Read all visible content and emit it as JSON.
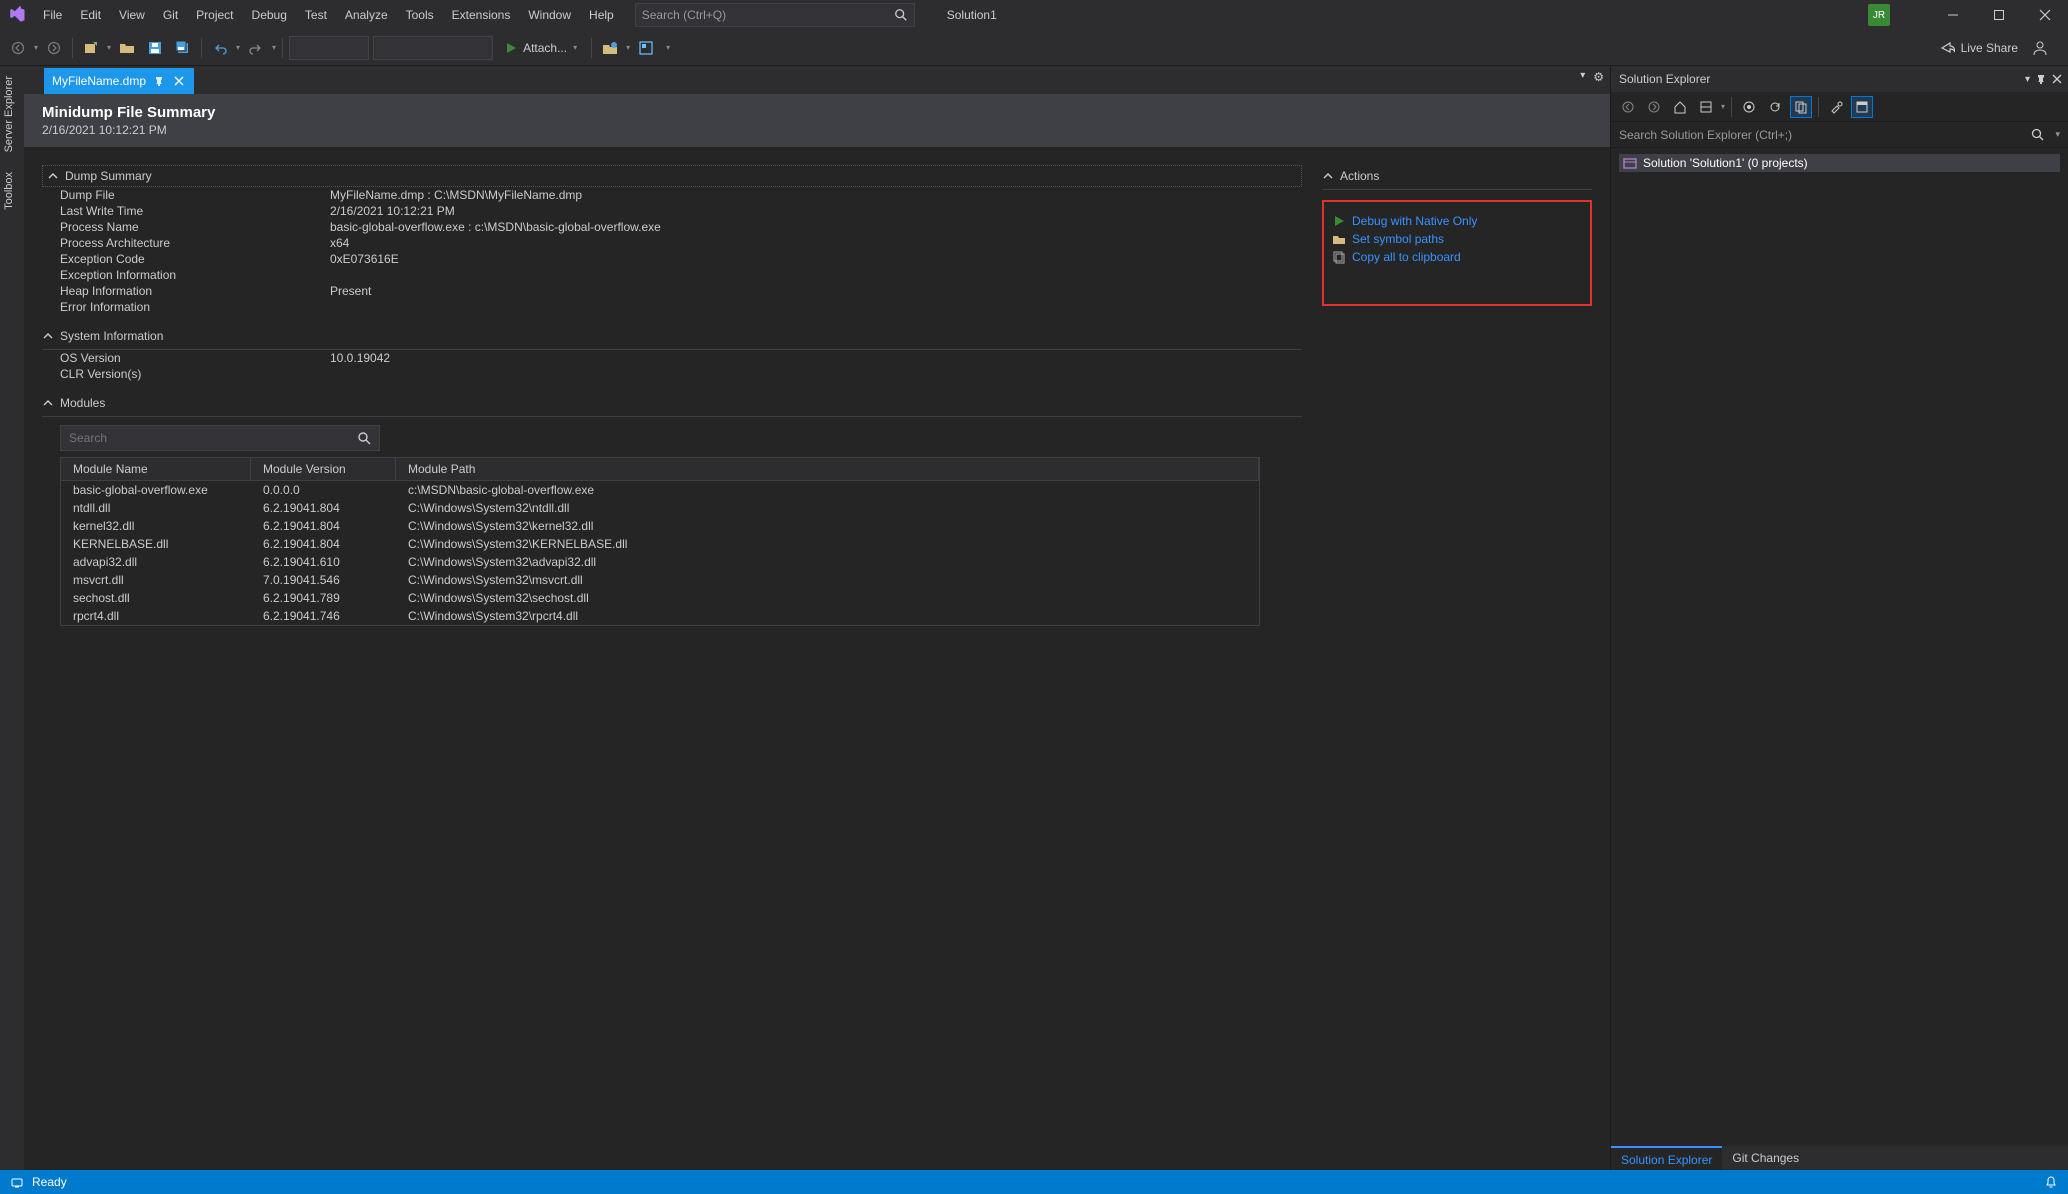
{
  "menu": [
    "File",
    "Edit",
    "View",
    "Git",
    "Project",
    "Debug",
    "Test",
    "Analyze",
    "Tools",
    "Extensions",
    "Window",
    "Help"
  ],
  "search_placeholder": "Search (Ctrl+Q)",
  "solution_name": "Solution1",
  "user_initials": "JR",
  "toolbar": {
    "attach_label": "Attach...",
    "live_share": "Live Share"
  },
  "left_tabs": [
    "Server Explorer",
    "Toolbox"
  ],
  "doc_tab": {
    "name": "MyFileName.dmp"
  },
  "doc": {
    "title": "Minidump File Summary",
    "subtitle": "2/16/2021 10:12:21 PM",
    "sections": {
      "dump": {
        "heading": "Dump Summary",
        "rows": [
          {
            "k": "Dump File",
            "v": "MyFileName.dmp : C:\\MSDN\\MyFileName.dmp"
          },
          {
            "k": "Last Write Time",
            "v": "2/16/2021 10:12:21 PM"
          },
          {
            "k": "Process Name",
            "v": "basic-global-overflow.exe : c:\\MSDN\\basic-global-overflow.exe"
          },
          {
            "k": "Process Architecture",
            "v": "x64"
          },
          {
            "k": "Exception Code",
            "v": "0xE073616E"
          },
          {
            "k": "Exception Information",
            "v": ""
          },
          {
            "k": "Heap Information",
            "v": "Present"
          },
          {
            "k": "Error Information",
            "v": ""
          }
        ]
      },
      "sys": {
        "heading": "System Information",
        "rows": [
          {
            "k": "OS Version",
            "v": "10.0.19042"
          },
          {
            "k": "CLR Version(s)",
            "v": ""
          }
        ]
      },
      "modules": {
        "heading": "Modules",
        "search_placeholder": "Search",
        "columns": [
          "Module Name",
          "Module Version",
          "Module Path"
        ],
        "rows": [
          {
            "name": "basic-global-overflow.exe",
            "ver": "0.0.0.0",
            "path": "c:\\MSDN\\basic-global-overflow.exe"
          },
          {
            "name": "ntdll.dll",
            "ver": "6.2.19041.804",
            "path": "C:\\Windows\\System32\\ntdll.dll"
          },
          {
            "name": "kernel32.dll",
            "ver": "6.2.19041.804",
            "path": "C:\\Windows\\System32\\kernel32.dll"
          },
          {
            "name": "KERNELBASE.dll",
            "ver": "6.2.19041.804",
            "path": "C:\\Windows\\System32\\KERNELBASE.dll"
          },
          {
            "name": "advapi32.dll",
            "ver": "6.2.19041.610",
            "path": "C:\\Windows\\System32\\advapi32.dll"
          },
          {
            "name": "msvcrt.dll",
            "ver": "7.0.19041.546",
            "path": "C:\\Windows\\System32\\msvcrt.dll"
          },
          {
            "name": "sechost.dll",
            "ver": "6.2.19041.789",
            "path": "C:\\Windows\\System32\\sechost.dll"
          },
          {
            "name": "rpcrt4.dll",
            "ver": "6.2.19041.746",
            "path": "C:\\Windows\\System32\\rpcrt4.dll"
          }
        ]
      },
      "actions": {
        "heading": "Actions",
        "items": [
          {
            "icon": "play",
            "label": "Debug with Native Only"
          },
          {
            "icon": "folder",
            "label": "Set symbol paths"
          },
          {
            "icon": "copy",
            "label": "Copy all to clipboard"
          }
        ]
      }
    }
  },
  "sol_explorer": {
    "title": "Solution Explorer",
    "search_placeholder": "Search Solution Explorer (Ctrl+;)",
    "root": "Solution 'Solution1' (0 projects)",
    "bottom_tabs": [
      "Solution Explorer",
      "Git Changes"
    ]
  },
  "status": {
    "ready": "Ready"
  }
}
